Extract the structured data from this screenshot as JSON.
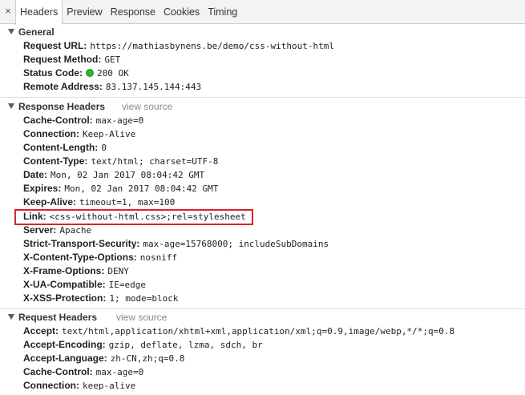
{
  "tabs": {
    "close": "×",
    "items": [
      "Headers",
      "Preview",
      "Response",
      "Cookies",
      "Timing"
    ],
    "active": "Headers"
  },
  "general": {
    "title": "General",
    "rows": [
      {
        "key": "Request URL:",
        "value": "https://mathiasbynens.be/demo/css-without-html"
      },
      {
        "key": "Request Method:",
        "value": "GET"
      },
      {
        "key": "Status Code:",
        "value": "200 OK"
      },
      {
        "key": "Remote Address:",
        "value": "83.137.145.144:443"
      }
    ]
  },
  "response_headers": {
    "title": "Response Headers",
    "view_source": "view source",
    "rows": [
      {
        "key": "Cache-Control:",
        "value": "max-age=0"
      },
      {
        "key": "Connection:",
        "value": "Keep-Alive"
      },
      {
        "key": "Content-Length:",
        "value": "0"
      },
      {
        "key": "Content-Type:",
        "value": "text/html; charset=UTF-8"
      },
      {
        "key": "Date:",
        "value": "Mon, 02 Jan 2017 08:04:42 GMT"
      },
      {
        "key": "Expires:",
        "value": "Mon, 02 Jan 2017 08:04:42 GMT"
      },
      {
        "key": "Keep-Alive:",
        "value": "timeout=1, max=100"
      },
      {
        "key": "Link:",
        "value": "<css-without-html.css>;rel=stylesheet"
      },
      {
        "key": "Server:",
        "value": "Apache"
      },
      {
        "key": "Strict-Transport-Security:",
        "value": "max-age=15768000; includeSubDomains"
      },
      {
        "key": "X-Content-Type-Options:",
        "value": "nosniff"
      },
      {
        "key": "X-Frame-Options:",
        "value": "DENY"
      },
      {
        "key": "X-UA-Compatible:",
        "value": "IE=edge"
      },
      {
        "key": "X-XSS-Protection:",
        "value": "1; mode=block"
      }
    ]
  },
  "request_headers": {
    "title": "Request Headers",
    "view_source": "view source",
    "rows": [
      {
        "key": "Accept:",
        "value": "text/html,application/xhtml+xml,application/xml;q=0.9,image/webp,*/*;q=0.8"
      },
      {
        "key": "Accept-Encoding:",
        "value": "gzip, deflate, lzma, sdch, br"
      },
      {
        "key": "Accept-Language:",
        "value": "zh-CN,zh;q=0.8"
      },
      {
        "key": "Cache-Control:",
        "value": "max-age=0"
      },
      {
        "key": "Connection:",
        "value": "keep-alive"
      }
    ]
  },
  "colors": {
    "status_ok": "#2eb82e",
    "highlight_border": "#d8232a"
  },
  "icons": {
    "status": "green-circle-icon",
    "section_toggle": "triangle-down-icon"
  }
}
